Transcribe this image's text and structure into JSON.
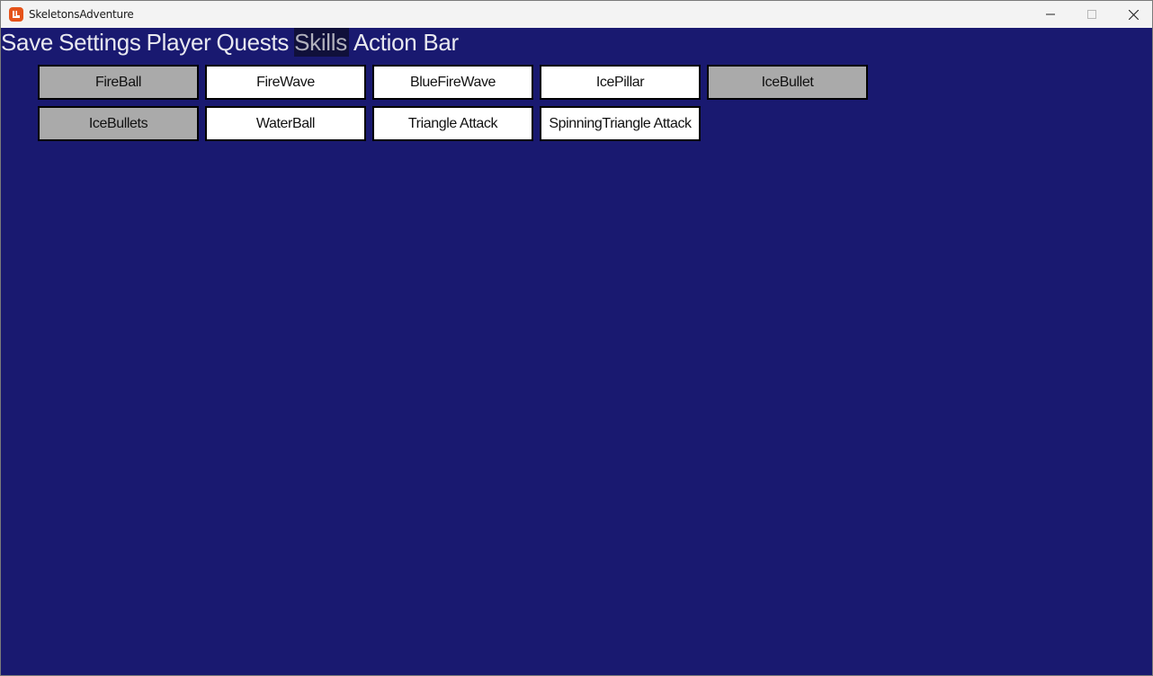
{
  "window": {
    "title": "SkeletonsAdventure",
    "icon": "monogame-icon",
    "controls": [
      "minimize-icon",
      "maximize-icon",
      "close-icon"
    ]
  },
  "colors": {
    "background": "#191970",
    "menu_text": "#e8e8f0",
    "menu_active_bg": "#10103a",
    "skill_unlocked": "#ffffff",
    "skill_locked": "#aaaaaa"
  },
  "menu": {
    "items": [
      {
        "label": "Save",
        "active": false
      },
      {
        "label": "Settings",
        "active": false
      },
      {
        "label": "Player",
        "active": false
      },
      {
        "label": "Quests",
        "active": false
      },
      {
        "label": "Skills",
        "active": true
      },
      {
        "label": "Action Bar",
        "active": false
      }
    ]
  },
  "skills": {
    "rows": [
      [
        {
          "label": "FireBall",
          "locked": true
        },
        {
          "label": "FireWave",
          "locked": false
        },
        {
          "label": "BlueFireWave",
          "locked": false
        },
        {
          "label": "IcePillar",
          "locked": false
        },
        {
          "label": "IceBullet",
          "locked": true
        }
      ],
      [
        {
          "label": "IceBullets",
          "locked": true
        },
        {
          "label": "WaterBall",
          "locked": false
        },
        {
          "label": "Triangle Attack",
          "locked": false
        },
        {
          "label": "SpinningTriangle Attack",
          "locked": false
        }
      ]
    ]
  }
}
